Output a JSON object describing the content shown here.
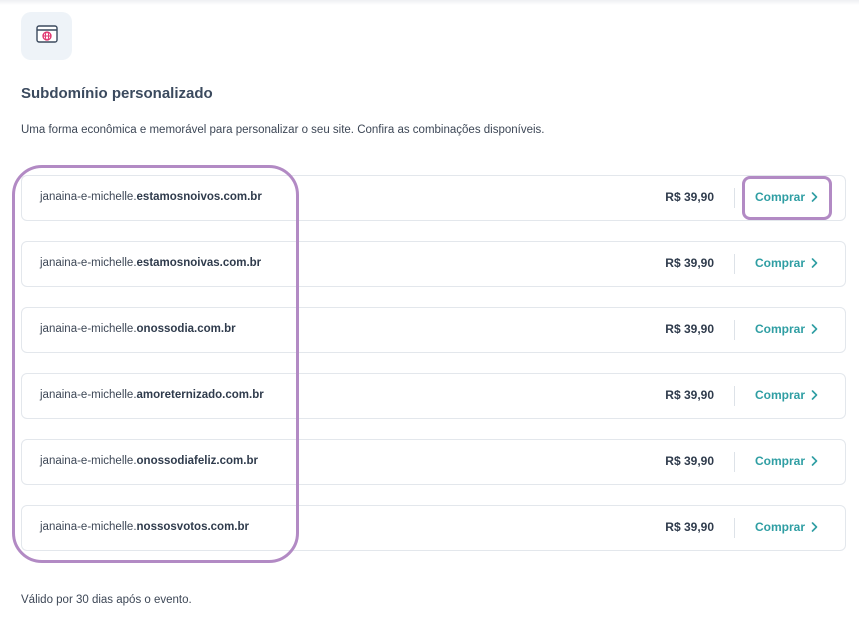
{
  "section": {
    "icon": "browser-globe-icon",
    "title": "Subdomínio personalizado",
    "description": "Uma forma econômica e memorável para personalizar o seu site. Confira as combinações disponíveis."
  },
  "domains": [
    {
      "prefix": "janaina-e-michelle.",
      "suffix": "estamosnoivos.com.br",
      "price": "R$ 39,90",
      "buy_label": "Comprar"
    },
    {
      "prefix": "janaina-e-michelle.",
      "suffix": "estamosnoivas.com.br",
      "price": "R$ 39,90",
      "buy_label": "Comprar"
    },
    {
      "prefix": "janaina-e-michelle.",
      "suffix": "onossodia.com.br",
      "price": "R$ 39,90",
      "buy_label": "Comprar"
    },
    {
      "prefix": "janaina-e-michelle.",
      "suffix": "amoreternizado.com.br",
      "price": "R$ 39,90",
      "buy_label": "Comprar"
    },
    {
      "prefix": "janaina-e-michelle.",
      "suffix": "onossodiafeliz.com.br",
      "price": "R$ 39,90",
      "buy_label": "Comprar"
    },
    {
      "prefix": "janaina-e-michelle.",
      "suffix": "nossosvotos.com.br",
      "price": "R$ 39,90",
      "buy_label": "Comprar"
    }
  ],
  "footer_note": "Válido por 30 dias após o evento.",
  "colors": {
    "accent": "#2f9ea3",
    "highlight": "#b28ac4",
    "icon_globe": "#e0306b"
  }
}
